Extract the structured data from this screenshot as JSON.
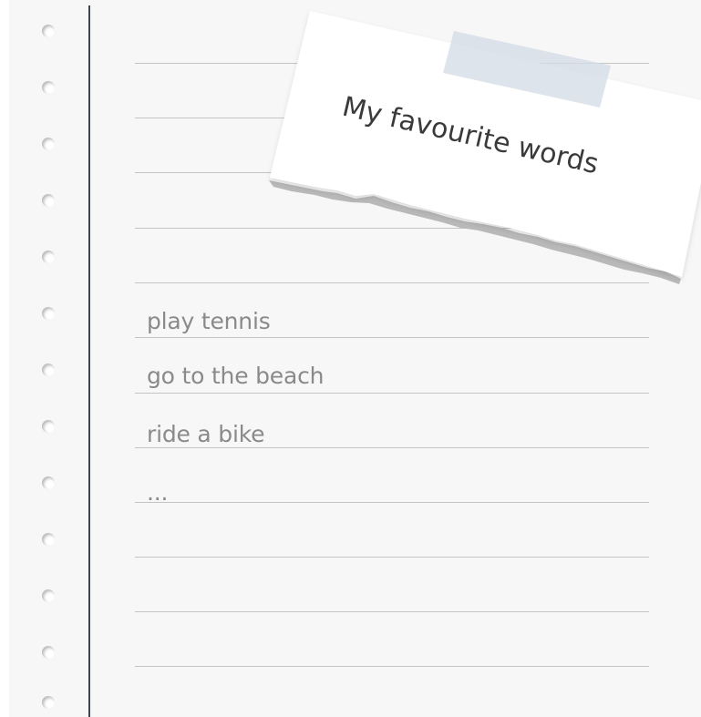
{
  "note": {
    "title": "My favourite words"
  },
  "words": [
    "play tennis",
    "go to the beach",
    "ride a bike",
    "..."
  ]
}
